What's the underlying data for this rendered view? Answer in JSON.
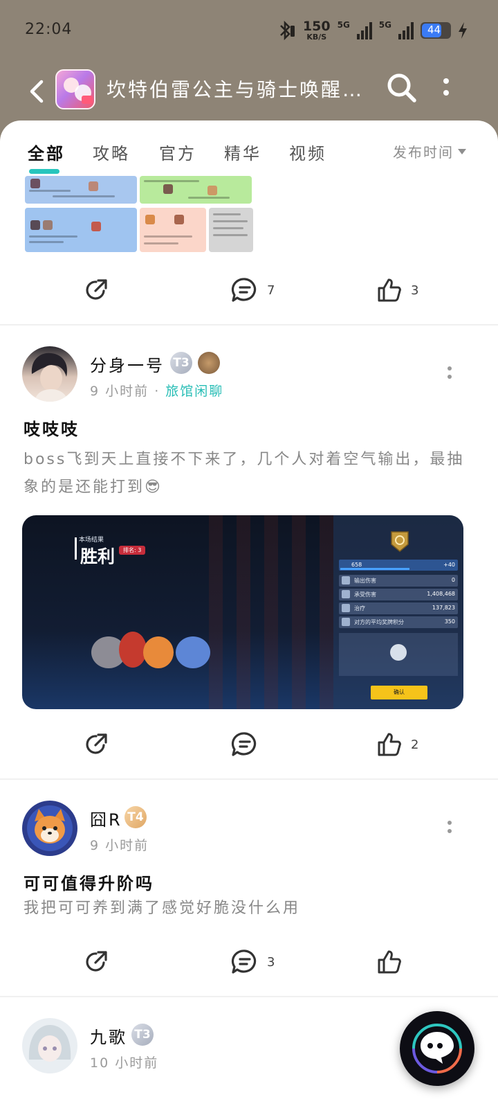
{
  "status_bar": {
    "time": "22:04",
    "net_speed": "150",
    "net_speed_unit": "KB/S",
    "sim1": "5G",
    "sim2": "5G",
    "battery": "44"
  },
  "header": {
    "title": "坎特伯雷公主与骑士唤醒…"
  },
  "tabs": [
    {
      "label": "全部",
      "active": true
    },
    {
      "label": "攻略",
      "active": false
    },
    {
      "label": "官方",
      "active": false
    },
    {
      "label": "精华",
      "active": false
    },
    {
      "label": "视频",
      "active": false
    }
  ],
  "sort": {
    "label": "发布时间"
  },
  "post0": {
    "comments": "7",
    "likes": "3"
  },
  "post1": {
    "username": "分身一号",
    "badge": "T3",
    "time": "9 小时前",
    "separator": "·",
    "forum": "旅馆闲聊",
    "title": "吱吱吱",
    "body": "boss飞到天上直接不下来了，几个人对着空气输出，最抽象的是还能打到😎",
    "comments": "",
    "likes": "2",
    "image": {
      "result_label": "本场结果",
      "result": "胜利",
      "rank": "排名: 3",
      "xp": "658",
      "xp_gain": "+40",
      "rows": [
        {
          "label": "输出伤害",
          "value": "0"
        },
        {
          "label": "承受伤害",
          "value": "1,408,468"
        },
        {
          "label": "治疗",
          "value": "137,823"
        },
        {
          "label": "对方的平均奖牌积分",
          "value": "350"
        }
      ],
      "confirm": "确认"
    }
  },
  "post2": {
    "username": "囧R",
    "badge": "T4",
    "time": "9 小时前",
    "title": "可可值得升阶吗",
    "body": "我把可可养到满了感觉好脆没什么用",
    "comments": "3",
    "likes": ""
  },
  "post3": {
    "username": "九歌",
    "badge": "T3",
    "time": "10 小时前"
  },
  "colors": {
    "header_bg": "#8e8476",
    "accent": "#27c5bd",
    "battery": "#3b7bf5"
  }
}
